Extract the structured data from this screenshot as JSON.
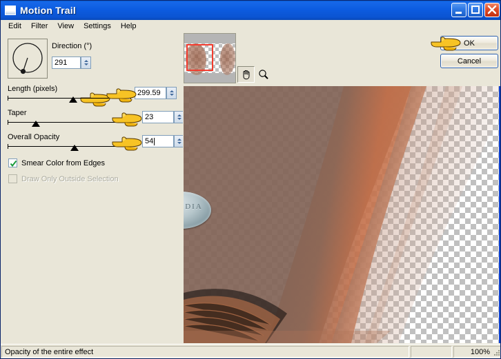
{
  "window": {
    "title": "Motion Trail",
    "icon": "app-icon",
    "buttons": {
      "minimize": "minimize-button",
      "maximize": "maximize-button",
      "close": "close-button"
    }
  },
  "menubar": {
    "items": [
      {
        "label": "Edit"
      },
      {
        "label": "Filter"
      },
      {
        "label": "View"
      },
      {
        "label": "Settings"
      },
      {
        "label": "Help"
      }
    ]
  },
  "controls": {
    "direction": {
      "label": "Direction (°)",
      "value": "291",
      "dial_angle_deg": 291
    },
    "length": {
      "label": "Length (pixels)",
      "value": "299.59",
      "thumb_percent": 53
    },
    "taper": {
      "label": "Taper",
      "value": "23",
      "thumb_percent": 23
    },
    "opacity": {
      "label": "Overall Opacity",
      "value": "54",
      "thumb_percent": 54
    },
    "checkboxes": [
      {
        "label": "Smear Color from Edges",
        "checked": true,
        "enabled": true
      },
      {
        "label": "Draw Only Outside Selection",
        "checked": false,
        "enabled": false
      }
    ]
  },
  "preview": {
    "navigator": {
      "name": "preview-navigator",
      "viewport_color": "#f23b2e"
    },
    "tools": [
      {
        "name": "pan-tool",
        "icon": "hand-icon",
        "active": true
      },
      {
        "name": "zoom-tool",
        "icon": "magnifier-icon",
        "active": false
      }
    ],
    "watermark": {
      "text": "CLAUDIA",
      "subtext": "⚘"
    }
  },
  "dialog_buttons": {
    "ok": "OK",
    "cancel": "Cancel"
  },
  "statusbar": {
    "message": "Opacity of the entire effect",
    "secondary": "",
    "zoom": "100%"
  },
  "colors": {
    "titlebar_blue": "#0c5ce0",
    "panel": "#e9e6d8",
    "accent_border": "#7f9db9",
    "preview_border": "#0b3fd0",
    "checkmark_green": "#1a9b3a",
    "hand_yellow": "#f5c518"
  }
}
